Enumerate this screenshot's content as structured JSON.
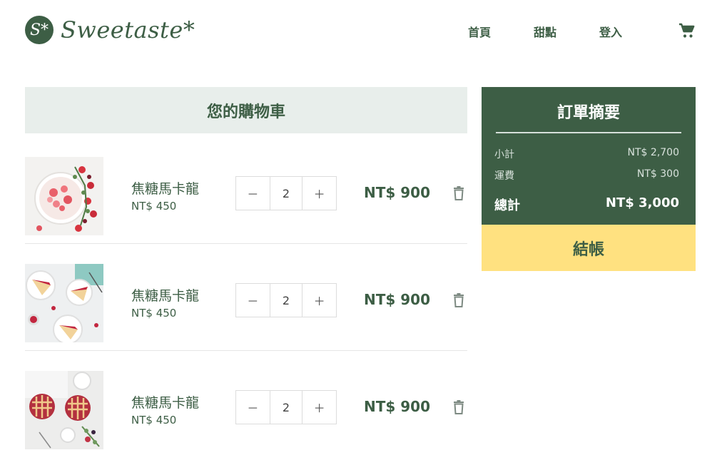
{
  "brand": {
    "badge": "S*",
    "name": "Sweetaste*"
  },
  "nav": {
    "home": "首頁",
    "desserts": "甜點",
    "login": "登入"
  },
  "cart": {
    "title": "您的購物車",
    "items": [
      {
        "name": "焦糖馬卡龍",
        "unit_price": "NT$ 450",
        "qty": "2",
        "total": "NT$ 900",
        "image": "strawberry-cake-photo"
      },
      {
        "name": "焦糖馬卡龍",
        "unit_price": "NT$ 450",
        "qty": "2",
        "total": "NT$ 900",
        "image": "berry-cake-slices-photo"
      },
      {
        "name": "焦糖馬卡龍",
        "unit_price": "NT$ 450",
        "qty": "2",
        "total": "NT$ 900",
        "image": "berry-tarts-photo"
      }
    ],
    "minus": "－",
    "plus": "＋"
  },
  "summary": {
    "title": "訂單摘要",
    "subtotal_label": "小計",
    "subtotal": "NT$ 2,700",
    "shipping_label": "運費",
    "shipping": "NT$ 300",
    "total_label": "總計",
    "total": "NT$ 3,000",
    "checkout": "結帳"
  },
  "colors": {
    "brand_green": "#3d5e45",
    "title_bg": "#e8eeeb",
    "checkout_yellow": "#ffe180"
  }
}
